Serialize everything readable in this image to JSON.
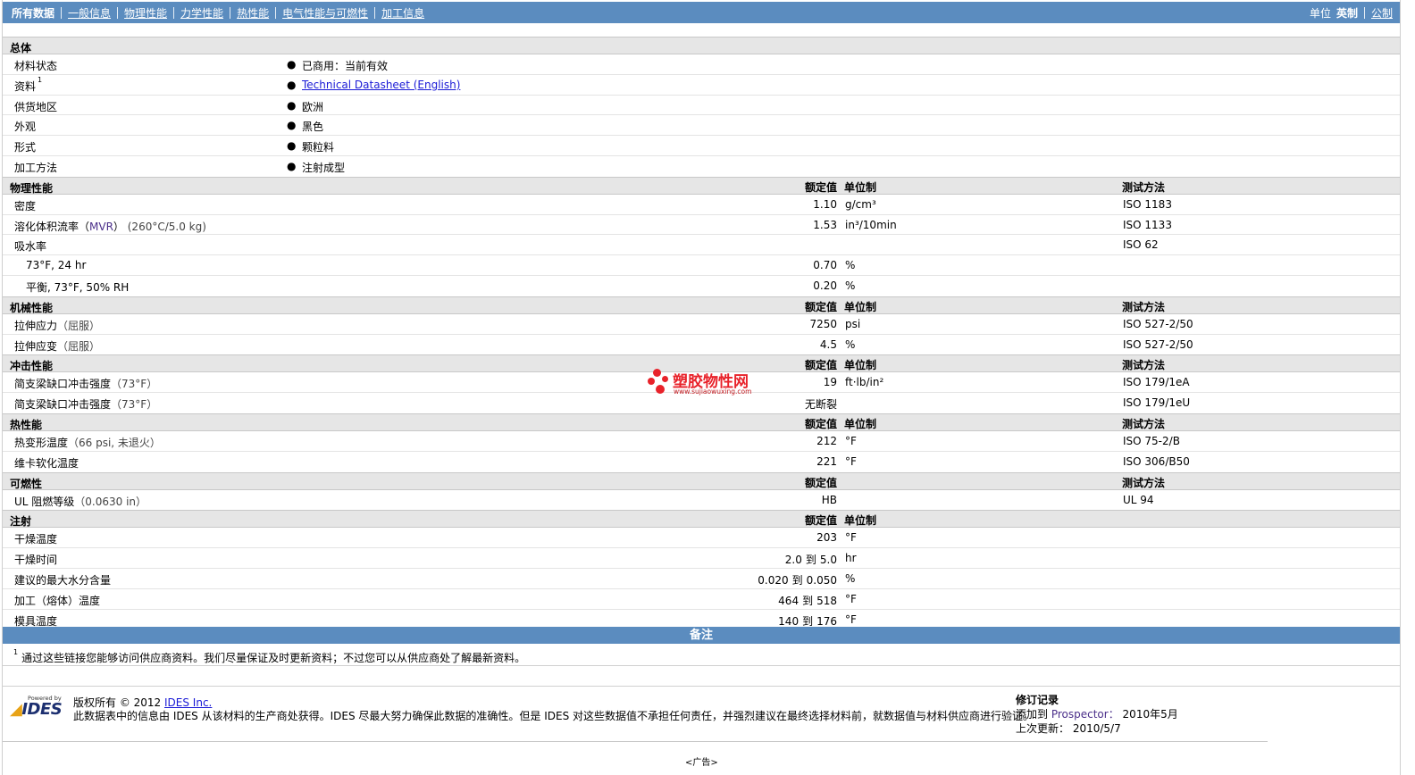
{
  "nav": {
    "tabs": [
      "所有数据",
      "一般信息",
      "物理性能",
      "力学性能",
      "热性能",
      "电气性能与可燃性",
      "加工信息"
    ],
    "units_label": "单位",
    "unit_english": "英制",
    "unit_metric": "公制"
  },
  "sections": {
    "general": {
      "title": "总体",
      "rows": [
        {
          "name": "材料状态",
          "value": "已商用：当前有效"
        },
        {
          "name": "资料",
          "sup": "1",
          "value": "Technical Datasheet (English)"
        },
        {
          "name": "供货地区",
          "value": "欧洲"
        },
        {
          "name": "外观",
          "value": "黑色"
        },
        {
          "name": "形式",
          "value": "颗粒料"
        },
        {
          "name": "加工方法",
          "value": "注射成型"
        }
      ]
    },
    "physical": {
      "title": "物理性能",
      "col_value": "额定值",
      "col_unit": "单位制",
      "col_test": "测试方法",
      "rows": [
        {
          "name": "密度",
          "value": "1.10",
          "unit": "g/cm³",
          "test": "ISO 1183"
        },
        {
          "name": "溶化体积流率（",
          "abbr": "MVR",
          "name_after": "）",
          "paren": " (260°C/5.0 kg)",
          "value": "1.53",
          "unit": "in³/10min",
          "test": "ISO 1133"
        },
        {
          "name": "吸水率",
          "value": "",
          "unit": "",
          "test": "ISO 62"
        },
        {
          "name": "73°F, 24 hr",
          "sub": true,
          "value": "0.70",
          "unit": "%",
          "test": ""
        },
        {
          "name": "平衡, 73°F, 50% RH",
          "sub": true,
          "value": "0.20",
          "unit": "%",
          "test": ""
        }
      ]
    },
    "mechanical": {
      "title": "机械性能",
      "col_value": "额定值",
      "col_unit": "单位制",
      "col_test": "测试方法",
      "rows": [
        {
          "name": "拉伸应力",
          "paren": "（屈服）",
          "value": "7250",
          "unit": "psi",
          "test": "ISO 527-2/50"
        },
        {
          "name": "拉伸应变",
          "paren": "（屈服）",
          "value": "4.5",
          "unit": "%",
          "test": "ISO 527-2/50"
        }
      ]
    },
    "impact": {
      "title": "冲击性能",
      "col_value": "额定值",
      "col_unit": "单位制",
      "col_test": "测试方法",
      "rows": [
        {
          "name": "简支梁缺口冲击强度",
          "paren": "（73°F）",
          "value": "19",
          "unit": "ft·lb/in²",
          "test": "ISO 179/1eA"
        },
        {
          "name": "简支梁缺口冲击强度",
          "paren": "（73°F）",
          "value": "无断裂",
          "unit": "",
          "test": "ISO 179/1eU"
        }
      ]
    },
    "thermal": {
      "title": "热性能",
      "col_value": "额定值",
      "col_unit": "单位制",
      "col_test": "测试方法",
      "rows": [
        {
          "name": "热变形温度",
          "paren": "（66 psi, 未退火）",
          "value": "212",
          "unit": "°F",
          "test": "ISO 75-2/B"
        },
        {
          "name": "维卡软化温度",
          "value": "221",
          "unit": "°F",
          "test": "ISO 306/B50"
        }
      ]
    },
    "flammability": {
      "title": "可燃性",
      "col_value": "额定值",
      "col_test": "测试方法",
      "rows": [
        {
          "name": "UL 阻燃等级",
          "paren": "（0.0630 in）",
          "value": "HB",
          "unit": "",
          "test": "UL 94"
        }
      ]
    },
    "injection": {
      "title": "注射",
      "col_value": "额定值",
      "col_unit": "单位制",
      "rows": [
        {
          "name": "干燥温度",
          "value": "203",
          "unit": "°F"
        },
        {
          "name": "干燥时间",
          "from": "2.0",
          "to_word": "到",
          "to": "5.0",
          "unit": "hr"
        },
        {
          "name": "建议的最大水分含量",
          "from": "0.020",
          "to_word": "到",
          "to": "0.050",
          "unit": "%"
        },
        {
          "name": "加工（熔体）温度",
          "from": "464",
          "to_word": "到",
          "to": "518",
          "unit": "°F"
        },
        {
          "name": "模具温度",
          "from": "140",
          "to_word": "到",
          "to": "176",
          "unit": "°F"
        }
      ]
    }
  },
  "watermark": {
    "cn": "塑胶物性网",
    "url": "www.sujiaowuxing.com"
  },
  "notes": {
    "title": "备注",
    "sup": "1",
    "text": "通过这些链接您能够访问供应商资料。我们尽量保证及时更新资料；不过您可以从供应商处了解最新资料。"
  },
  "footer": {
    "powered_by": "Powered by",
    "logo_text": "IDES",
    "copyright_prefix": "版权所有 © 2012",
    "copyright_link": "IDES Inc.",
    "disclaimer": "此数据表中的信息由 IDES 从该材料的生产商处获得。IDES 尽最大努力确保此数据的准确性。但是 IDES 对这些数据值不承担任何责任，并强烈建议在最终选择材料前，就数据值与材料供应商进行验证。",
    "revision_title": "修订记录",
    "added_label": "添加到",
    "added_site": "Prospector：",
    "added_date": "2010年5月",
    "updated_label": "上次更新：",
    "updated_date": "2010/5/7",
    "ad": "<广告>"
  },
  "colors": {
    "nav_bg": "#5b8cbf",
    "header_bg": "#e6e6e6",
    "link": "#1a1ad6",
    "watermark": "#e8222a"
  }
}
